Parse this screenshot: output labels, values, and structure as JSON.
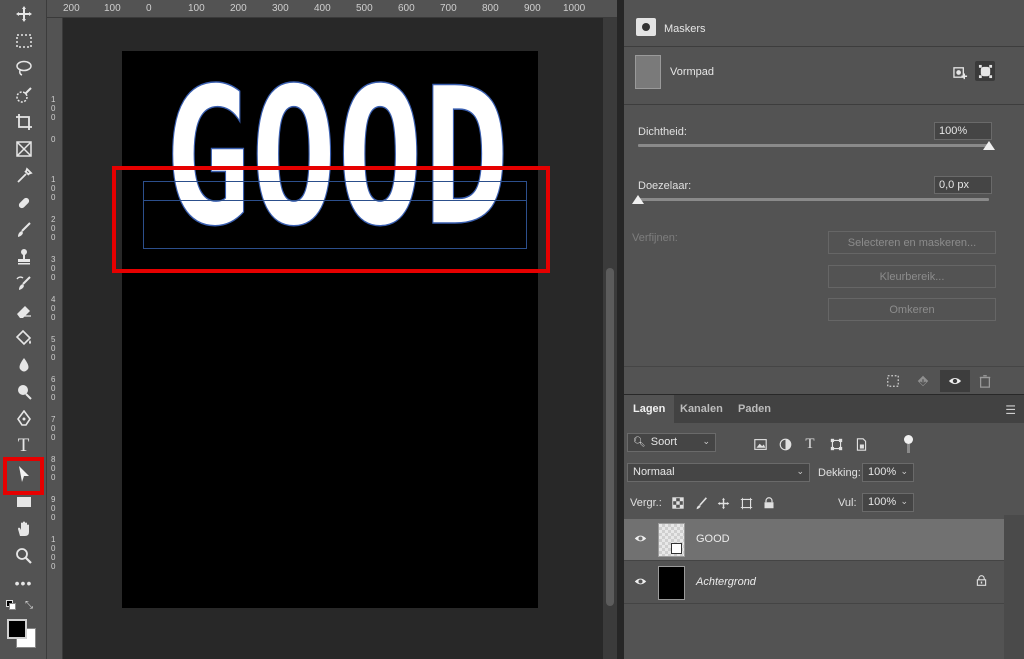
{
  "ruler": {
    "top_ticks": [
      "200",
      "100",
      "0",
      "100",
      "200",
      "300",
      "400",
      "500",
      "600",
      "700",
      "800",
      "900",
      "1000"
    ],
    "left_ticks": [
      "1\n0\n0",
      "0",
      "1\n0\n0",
      "2\n0\n0",
      "3\n0\n0",
      "4\n0\n0",
      "5\n0\n0",
      "6\n0\n0",
      "7\n0\n0",
      "8\n0\n0",
      "9\n0\n0",
      "1\n0\n0\n0"
    ]
  },
  "canvas": {
    "text_layer": "GOOD"
  },
  "properties": {
    "title": "Maskers",
    "mask_name": "Vormpad",
    "density_label": "Dichtheid:",
    "density_value": "100%",
    "density_level": 1.0,
    "feather_label": "Doezelaar:",
    "feather_value": "0,0 px",
    "feather_level": 0.0,
    "refine_label": "Verfijnen:",
    "select_mask_button": "Selecteren en maskeren...",
    "color_range_button": "Kleurbereik...",
    "invert_button": "Omkeren"
  },
  "layers_panel": {
    "tabs": [
      "Lagen",
      "Kanalen",
      "Paden"
    ],
    "filter_kind": "Soort",
    "blend_mode": "Normaal",
    "opacity_label": "Dekking:",
    "opacity_value": "100%",
    "lock_label": "Vergr.:",
    "fill_label": "Vul:",
    "fill_value": "100%",
    "layers": [
      {
        "name": "GOOD",
        "selected": true,
        "italic": false
      },
      {
        "name": "Achtergrond",
        "selected": false,
        "italic": true
      }
    ]
  },
  "colors": {
    "highlight": "#e60000",
    "text_fill": "#ffffff",
    "path_outline": "#3a5fb0"
  },
  "icons": {
    "tools": [
      "move-icon",
      "marquee-icon",
      "lasso-icon",
      "quick-select-icon",
      "crop-icon",
      "frame-icon",
      "eyedropper-icon",
      "healing-icon",
      "brush-icon",
      "stamp-icon",
      "history-brush-icon",
      "eraser-icon",
      "paint-bucket-icon",
      "blur-icon",
      "dodge-icon",
      "pen-icon",
      "type-icon",
      "path-selection-icon",
      "rectangle-icon",
      "hand-icon",
      "zoom-icon",
      "more-icon"
    ]
  }
}
